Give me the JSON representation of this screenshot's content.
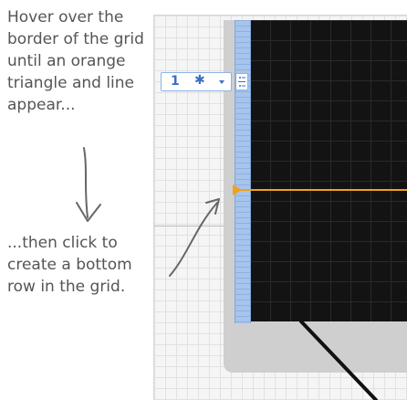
{
  "annotations": {
    "top": "Hover over the\nborder of the grid\nuntil an orange\ntriangle and line\nappear...",
    "bottom": "...then click to\ncreate a bottom\nrow in the grid."
  },
  "row_size_box": {
    "value": "1",
    "unit": "✱"
  },
  "icons": {
    "dropdown_caret": "chevron-down-icon",
    "row_handle": "row-handle-icon",
    "orange_triangle": "row-marker-triangle-icon"
  },
  "colors": {
    "orange_accent": "#f0a219",
    "ruler_blue": "#a7c4ec",
    "grid_dark": "#131313",
    "annotation_text": "#555555"
  }
}
